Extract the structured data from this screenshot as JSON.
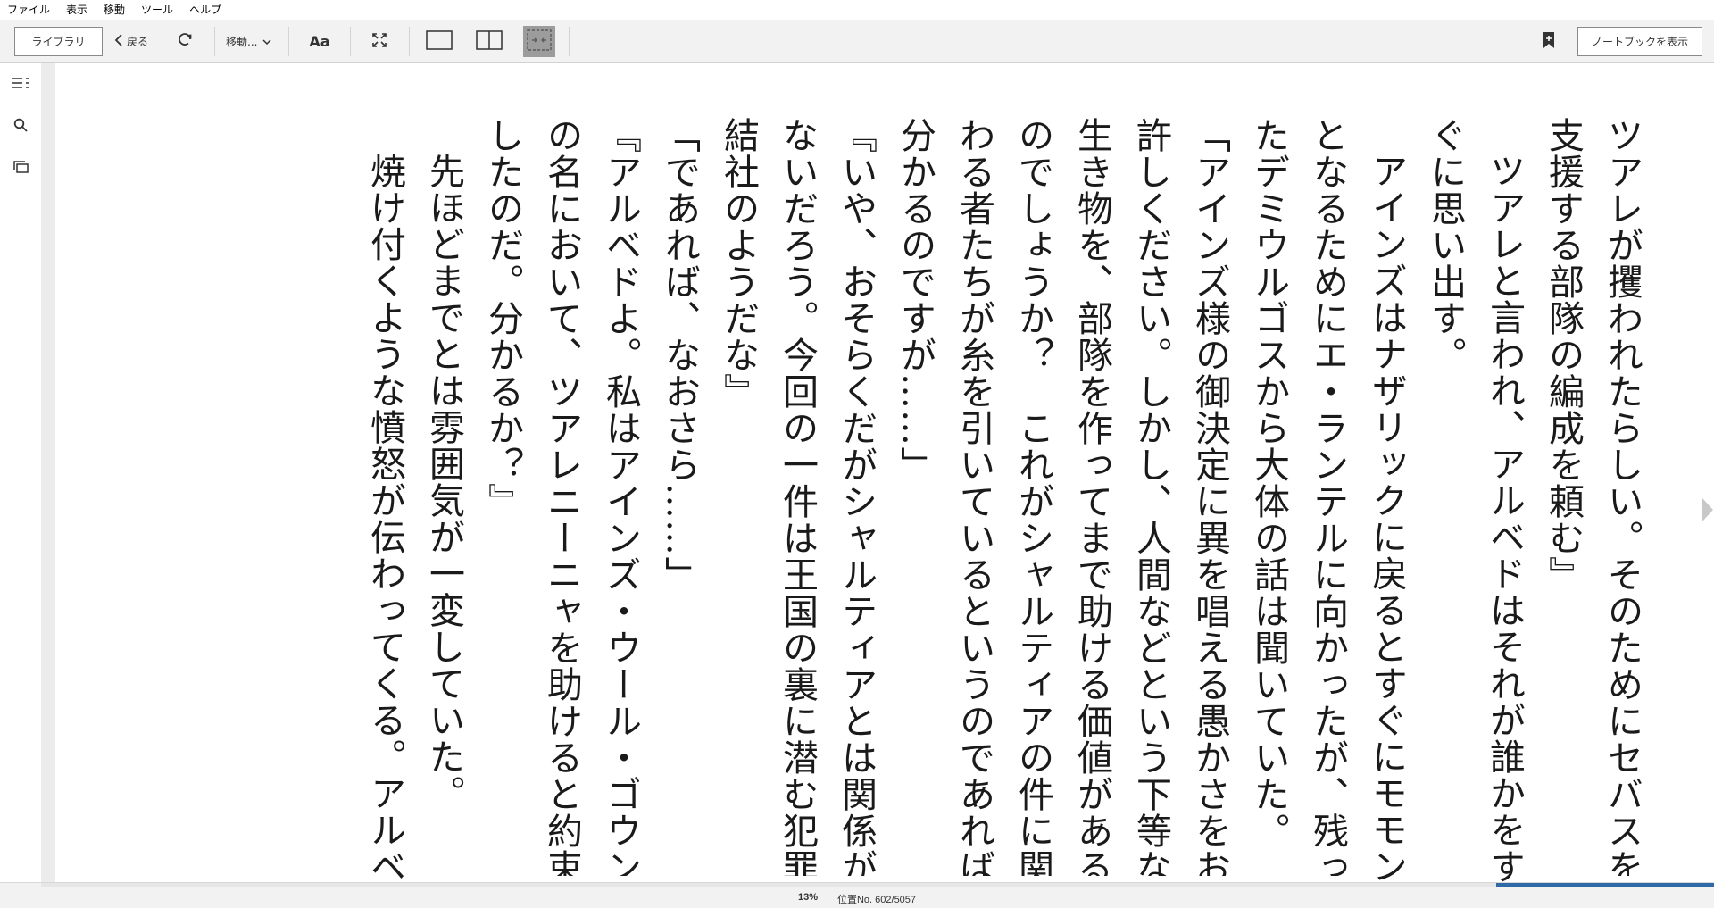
{
  "menu": [
    "ファイル",
    "表示",
    "移動",
    "ツール",
    "ヘルプ"
  ],
  "toolbar": {
    "library_label": "ライブラリ",
    "back_label": "戻る",
    "goto_label": "移動...",
    "font_label": "Aa",
    "notebook_label": "ノートブックを表示"
  },
  "book": {
    "lines": [
      "ツアレが攫われたらしい。そのためにセバスを",
      "支援する部隊の編成を頼む』",
      "ツアレと言われ、アルベドはそれが誰かをす",
      "ぐに思い出す。",
      "アインズはナザリックに戻るとすぐにモモン",
      "となるためにエ・ランテルに向かったが、残っ",
      "たデミウルゴスから大体の話は聞いていた。",
      "「アインズ様の御決定に異を唱える愚かさをお",
      "許しください。しかし、人間などという下等な",
      "生き物を、部隊を作ってまで助ける価値がある",
      "のでしょうか？　これがシャルティアの件に関",
      "わる者たちが糸を引いているというのであれば",
      "分かるのですが……」",
      "『いや、おそらくだがシャルティアとは関係が",
      "ないだろう。今回の一件は王国の裏に潜む犯罪",
      "結社のようだな』",
      "「であれば、なおさら……」",
      "『アルベドよ。私はアインズ・ウール・ゴウン",
      "の名において、ツアレニーニャを助けると約束",
      "したのだ。分かるか？』",
      "先ほどまでとは雰囲気が一変していた。",
      "焼け付くような憤怒が伝わってくる。アルベ"
    ],
    "line_indent": [
      0,
      0,
      1,
      0,
      1,
      0,
      0,
      0,
      0,
      0,
      0,
      0,
      0,
      0,
      0,
      0,
      0,
      0,
      0,
      0,
      1,
      1
    ]
  },
  "status": {
    "percent": "13%",
    "location": "位置No. 602/5057",
    "progress": 0.13
  },
  "colors": {
    "accent": "#2f6aa6",
    "toolbar_bg": "#f2f2f2",
    "active_tool_bg": "#9c9c9c"
  },
  "icons": {
    "back": "chevron-left-icon",
    "refresh": "refresh-icon",
    "goto": "chevron-down-icon",
    "fullscreen": "fullscreen-icon",
    "single_page": "single-page-icon",
    "two_page": "two-page-icon",
    "fit": "fit-page-icon",
    "bookmark": "bookmark-add-icon",
    "toc": "toc-icon",
    "search": "search-icon",
    "flashcards": "flashcards-icon",
    "next": "next-page-icon"
  }
}
